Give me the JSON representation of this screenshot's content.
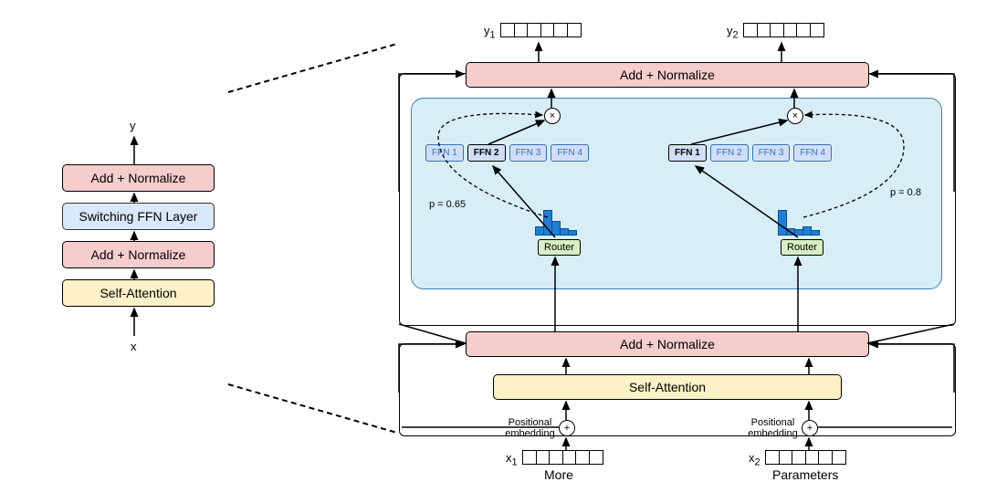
{
  "left": {
    "y_label": "y",
    "add_norm_top": "Add + Normalize",
    "switch_ffn": "Switching FFN Layer",
    "add_norm_bottom": "Add + Normalize",
    "self_attn": "Self-Attention",
    "x_label": "x"
  },
  "right": {
    "y1": "y",
    "y1_sub": "1",
    "y2": "y",
    "y2_sub": "2",
    "add_norm_top": "Add + Normalize",
    "ffn_left": [
      "FFN 1",
      "FFN 2",
      "FFN 3",
      "FFN 4"
    ],
    "ffn_right": [
      "FFN 1",
      "FFN 2",
      "FFN 3",
      "FFN 4"
    ],
    "p_left": "p = 0.65",
    "p_right": "p = 0.8",
    "router": "Router",
    "add_norm_bottom": "Add + Normalize",
    "self_attn": "Self-Attention",
    "pos_emb": "Positional\nembedding",
    "x1": "x",
    "x1_sub": "1",
    "x2": "x",
    "x2_sub": "2",
    "word_more": "More",
    "word_params": "Parameters"
  },
  "chart_data": {
    "type": "diagram",
    "description": "Switch Transformer architecture. Left: compact encoder block (Self-Attention -> Add+Normalize -> Switching FFN Layer -> Add+Normalize). Right: expanded view showing two token positions routed to different experts.",
    "experts_per_token": 4,
    "tokens": [
      {
        "input_label": "x1",
        "word": "More",
        "router_probs_hist": [
          0.15,
          0.65,
          0.1,
          0.1
        ],
        "selected_expert": "FFN 2",
        "selected_prob": 0.65,
        "output_label": "y1"
      },
      {
        "input_label": "x2",
        "word": "Parameters",
        "router_probs_hist": [
          0.8,
          0.05,
          0.05,
          0.1
        ],
        "selected_expert": "FFN 1",
        "selected_prob": 0.8,
        "output_label": "y2"
      }
    ],
    "blocks_left_to_right_dashed": true
  }
}
